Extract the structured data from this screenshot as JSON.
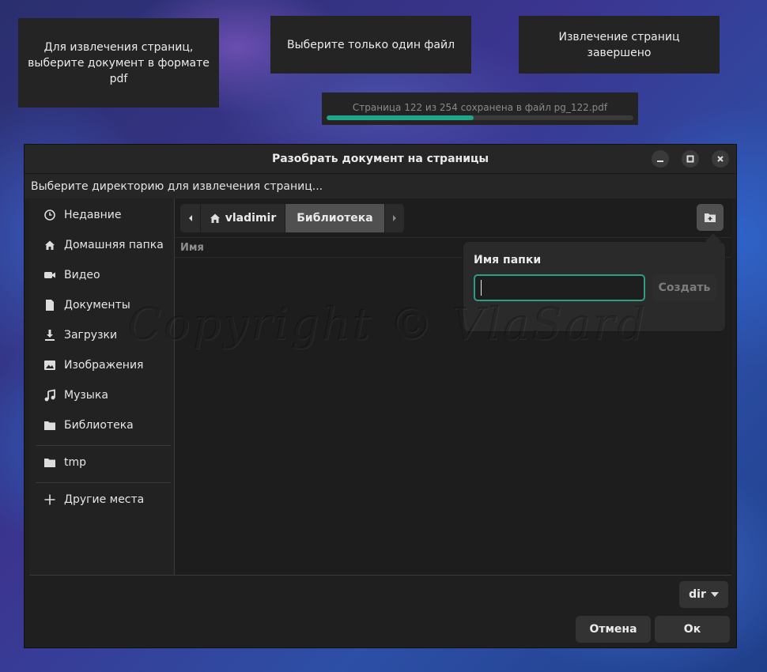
{
  "notifications": [
    {
      "text": "Для извлечения страниц, выберите документ в формате pdf"
    },
    {
      "text": "Выберите только один файл"
    },
    {
      "text": "Извлечение страниц завершено"
    }
  ],
  "progress": {
    "text": "Страница 122 из 254 сохранена в файл pg_122.pdf",
    "current": 122,
    "total": 254,
    "fraction": 0.48,
    "color": "#1fa58a"
  },
  "dialog": {
    "title": "Разобрать документ на страницы",
    "subtitle": "Выберите директорию для извлечения страниц...",
    "window_buttons": {
      "minimize": "minimize-icon",
      "maximize": "maximize-icon",
      "close": "close-icon"
    }
  },
  "sidebar": {
    "items": [
      {
        "label": "Недавние",
        "icon": "clock-icon"
      },
      {
        "label": "Домашняя папка",
        "icon": "home-icon"
      },
      {
        "label": "Видео",
        "icon": "video-icon"
      },
      {
        "label": "Документы",
        "icon": "document-icon"
      },
      {
        "label": "Загрузки",
        "icon": "download-icon"
      },
      {
        "label": "Изображения",
        "icon": "image-icon"
      },
      {
        "label": "Музыка",
        "icon": "music-icon"
      },
      {
        "label": "Библиотека",
        "icon": "folder-icon"
      },
      {
        "label": "tmp",
        "icon": "folder-icon"
      },
      {
        "label": "Другие места",
        "icon": "plus-icon"
      }
    ]
  },
  "pathbar": {
    "crumbs": [
      "vladimir",
      "Библиотека"
    ],
    "active": "Библиотека"
  },
  "file_list": {
    "column_name": "Имя"
  },
  "new_folder_popover": {
    "title": "Имя папки",
    "input_value": "",
    "create_label": "Создать"
  },
  "watermark": "Copyright © VlaSard",
  "footer": {
    "filter_label": "dir",
    "cancel_label": "Отмена",
    "ok_label": "Ок"
  }
}
